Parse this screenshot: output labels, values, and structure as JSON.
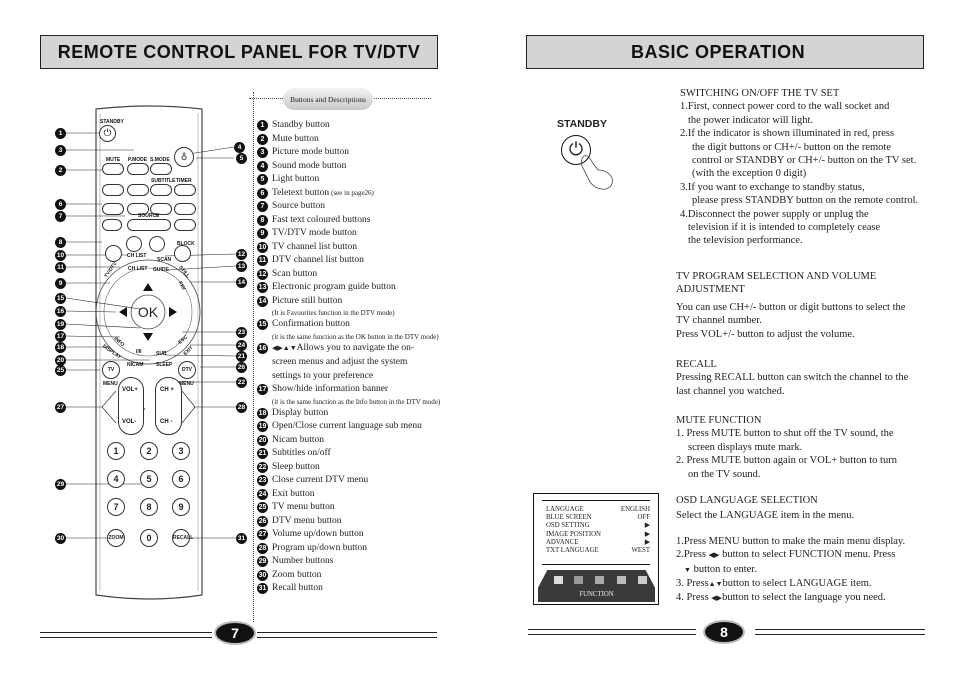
{
  "left_page": {
    "title": "REMOTE CONTROL PANEL FOR TV/DTV",
    "legend_header": "Buttons and Descriptions",
    "legend": [
      {
        "n": "1",
        "text": "Standby button"
      },
      {
        "n": "2",
        "text": "Mute button"
      },
      {
        "n": "3",
        "text": "Picture mode button"
      },
      {
        "n": "4",
        "text": "Sound mode button"
      },
      {
        "n": "5",
        "text": "Light button"
      },
      {
        "n": "6",
        "text": "Teletext button",
        "note": "(see in page26)"
      },
      {
        "n": "7",
        "text": "Source button"
      },
      {
        "n": "8",
        "text": "Fast text coloured buttons"
      },
      {
        "n": "9",
        "text": "TV/DTV mode button"
      },
      {
        "n": "10",
        "text": "TV channel list button"
      },
      {
        "n": "11",
        "text": "DTV channel list button"
      },
      {
        "n": "12",
        "text": "Scan button"
      },
      {
        "n": "13",
        "text": "Electronic program guide button"
      },
      {
        "n": "14",
        "text": "Picture still button",
        "sub": "(It is Favourites function in the DTV mode)"
      },
      {
        "n": "15",
        "text": "Confirmation button",
        "sub": "(it is the same function as the OK button in the DTV mode)"
      },
      {
        "n": "16",
        "text": "Allows you to navigate the on-screen menus and adjust the system settings to your preference",
        "lines": [
          "Allows you to navigate the on-",
          "screen menus and adjust the system",
          "settings to your preference"
        ]
      },
      {
        "n": "17",
        "text": "Show/hide information banner",
        "sub": "(it is the same function as the Info button in the DTV mode)"
      },
      {
        "n": "18",
        "text": "Display button"
      },
      {
        "n": "19",
        "text": "Open/Close current language sub menu"
      },
      {
        "n": "20",
        "text": "Nicam button"
      },
      {
        "n": "21",
        "text": "Subtitles on/off"
      },
      {
        "n": "22",
        "text": "Sleep button"
      },
      {
        "n": "23",
        "text": "Close current DTV menu"
      },
      {
        "n": "24",
        "text": "Exit button"
      },
      {
        "n": "25",
        "text": "TV menu button"
      },
      {
        "n": "26",
        "text": "DTV menu button"
      },
      {
        "n": "27",
        "text": "Volume up/down button"
      },
      {
        "n": "28",
        "text": "Program up/down button"
      },
      {
        "n": "29",
        "text": "Number buttons"
      },
      {
        "n": "30",
        "text": "Zoom button"
      },
      {
        "n": "31",
        "text": "Recall button"
      }
    ],
    "remote": {
      "standby": "STANDBY",
      "mute": "MUTE",
      "pmode": "P.MODE",
      "smode": "S.MODE",
      "subtitle": "SUBTITLE",
      "timer": "TIMER",
      "source": "SOURCE",
      "block": "BLOCK",
      "ch_list": "CH LIST",
      "scan": "SCAN",
      "still": "STILL",
      "tv_dtv": "TV/DTV",
      "ch_list2": "CH LIST",
      "guide": "GUIDE",
      "fav": "FAV",
      "ok": "OK",
      "info": "INFO",
      "display": "DISPLAY",
      "i_ii": "I/II",
      "nicam": "NICAM",
      "esc": "ESC",
      "exit": "EXIT",
      "sub": "SUB",
      "sleep": "SLEEP",
      "tv": "TV",
      "dtv": "DTV",
      "menu": "MENU",
      "vol_up": "VOL+",
      "vol_down": "VOL-",
      "ch_up": "CH +",
      "ch_down": "CH -",
      "digits": [
        "1",
        "2",
        "3",
        "4",
        "5",
        "6",
        "7",
        "8",
        "9"
      ],
      "zero": "0",
      "zoom": "ZOOM",
      "recall": "RECALL"
    },
    "page_number": "7"
  },
  "right_page": {
    "title": "BASIC OPERATION",
    "standby_label": "STANDBY",
    "switching": {
      "heading": "SWITCHING ON/OFF THE TV SET",
      "lines": [
        "1.First, connect power cord to the wall socket and",
        "the power indicator will light.",
        "2.If the indicator is shown illuminated in red, press",
        "the digit buttons or CH+/- button on the remote",
        "control or STANDBY or CH+/- button on the TV set.",
        "(with the exception 0 digit)",
        "3.If you want to exchange to standby status,",
        "please press STANDBY button on the remote control.",
        "4.Disconnect the power supply or unplug the",
        "television if it is intended to completely cease",
        "the television performance."
      ]
    },
    "program": {
      "heading_1": "TV PROGRAM SELECTION AND VOLUME",
      "heading_2": "ADJUSTMENT",
      "lines": [
        "You can use CH+/- button or digit buttons to select the",
        "TV channel number.",
        "Press VOL+/- button to adjust the volume."
      ]
    },
    "recall": {
      "heading": "RECALL",
      "lines": [
        "Pressing RECALL button can switch the channel to the",
        "last channel you watched."
      ]
    },
    "mute": {
      "heading": "MUTE FUNCTION",
      "lines": [
        "1. Press MUTE button to shut off the TV sound, the",
        "screen displays mute mark.",
        "2. Press MUTE button again or VOL+ button to turn",
        "on the TV sound."
      ]
    },
    "osd_menu": {
      "rows": [
        {
          "label": "LANGUAGE",
          "value": "ENGLISH"
        },
        {
          "label": "BLUE SCREEN",
          "value": "OFF"
        },
        {
          "label": "OSD SETTING",
          "value": "▶"
        },
        {
          "label": "IMAGE POSITION",
          "value": "▶"
        },
        {
          "label": "ADVANCE",
          "value": "▶"
        },
        {
          "label": "TXT LANGUAGE",
          "value": "WEST"
        }
      ],
      "tab_label": "FUNCTION"
    },
    "osd_language": {
      "heading": "OSD LANGUAGE SELECTION",
      "intro": "Select the LANGUAGE item in the menu.",
      "step1": "1.Press MENU button to make the main menu display.",
      "step2a": "2.Press",
      "step2b": "button to select FUNCTION menu. Press",
      "step2c": "button to enter.",
      "step3a": "3. Press",
      "step3b": "button to select LANGUAGE item.",
      "step4a": "4. Press",
      "step4b": "button to select the language you need."
    },
    "page_number": "8"
  }
}
